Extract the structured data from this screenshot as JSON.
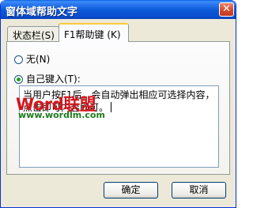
{
  "window": {
    "title": "窗体域帮助文字",
    "close_glyph": "✕"
  },
  "tabs": [
    {
      "label": "状态栏(S)",
      "selected": false
    },
    {
      "label": "F1帮助键 (K)",
      "selected": true
    }
  ],
  "options": {
    "none_label": "无(N)",
    "custom_label": "自己键入(T):",
    "selected": "custom"
  },
  "help_text": "当用户按F1后，会自动弹出相应可选择内容，点击即可内容即可。",
  "watermark": {
    "logo": "Word联盟",
    "url": "www.wordlm.com"
  },
  "buttons": {
    "ok": "确定",
    "cancel": "取消"
  },
  "colors": {
    "titlebar": "#0a4fd0",
    "dialog_bg": "#ece9d8",
    "tab_highlight": "#ffc83c",
    "watermark_red": "#d4141c",
    "watermark_green": "#1c7a1c"
  }
}
